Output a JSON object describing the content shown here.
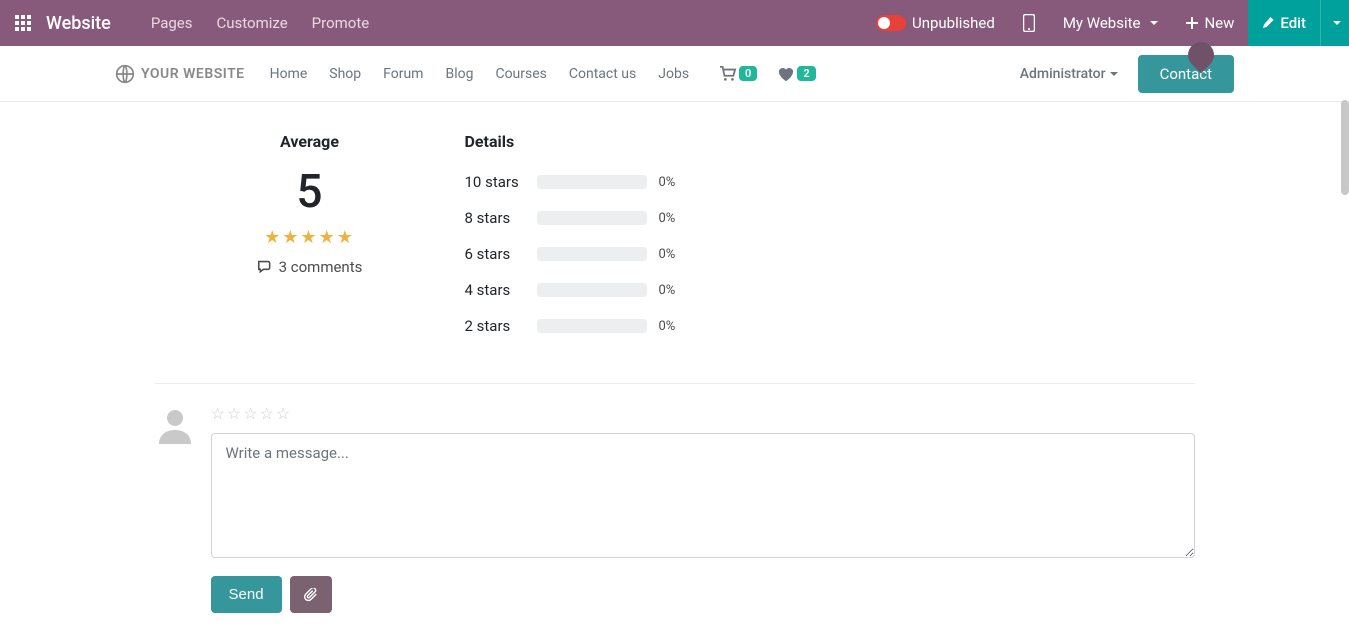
{
  "adminbar": {
    "brand": "Website",
    "menu": [
      "Pages",
      "Customize",
      "Promote"
    ],
    "unpublished": "Unpublished",
    "mywebsite": "My Website",
    "new": "New",
    "edit": "Edit"
  },
  "sitenav": {
    "logo_text": "YOUR WEBSITE",
    "links": [
      "Home",
      "Shop",
      "Forum",
      "Blog",
      "Courses",
      "Contact us",
      "Jobs"
    ],
    "cart_badge": "0",
    "wish_badge": "2",
    "admin": "Administrator",
    "contact": "Contact"
  },
  "rating": {
    "average_label": "Average",
    "average_value": "5",
    "comments_count": "3 comments",
    "details_label": "Details",
    "breakdown": [
      {
        "label": "10 stars",
        "pct": "0%"
      },
      {
        "label": "8 stars",
        "pct": "0%"
      },
      {
        "label": "6 stars",
        "pct": "0%"
      },
      {
        "label": "4 stars",
        "pct": "0%"
      },
      {
        "label": "2 stars",
        "pct": "0%"
      }
    ]
  },
  "comment": {
    "placeholder": "Write a message...",
    "send": "Send"
  }
}
